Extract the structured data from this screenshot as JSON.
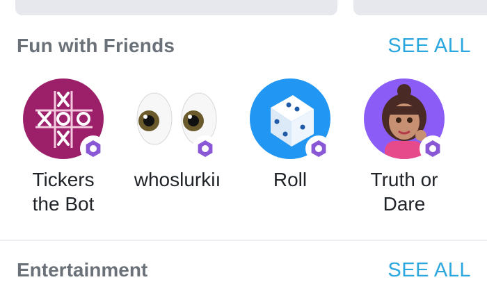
{
  "section": {
    "title": "Fun with Friends",
    "see_all": "SEE ALL"
  },
  "bots": [
    {
      "name_line1": "Tickers",
      "name_line2": "the Bot",
      "icon": "tic-tac-toe-icon"
    },
    {
      "name_line1": "whoslurkiı",
      "name_line2": "",
      "icon": "eyes-icon"
    },
    {
      "name_line1": "Roll",
      "name_line2": "",
      "icon": "dice-icon"
    },
    {
      "name_line1": "Truth or",
      "name_line2": "Dare",
      "icon": "girl-avatar-icon"
    }
  ],
  "next_section": {
    "title": "Entertainment",
    "see_all": "SEE ALL"
  },
  "colors": {
    "accent": "#2aa7df",
    "badge": "#8a57d6",
    "tickers_bg": "#9c1f6a",
    "roll_bg": "#2196f3",
    "truth_bg": "#8b5cf6"
  }
}
